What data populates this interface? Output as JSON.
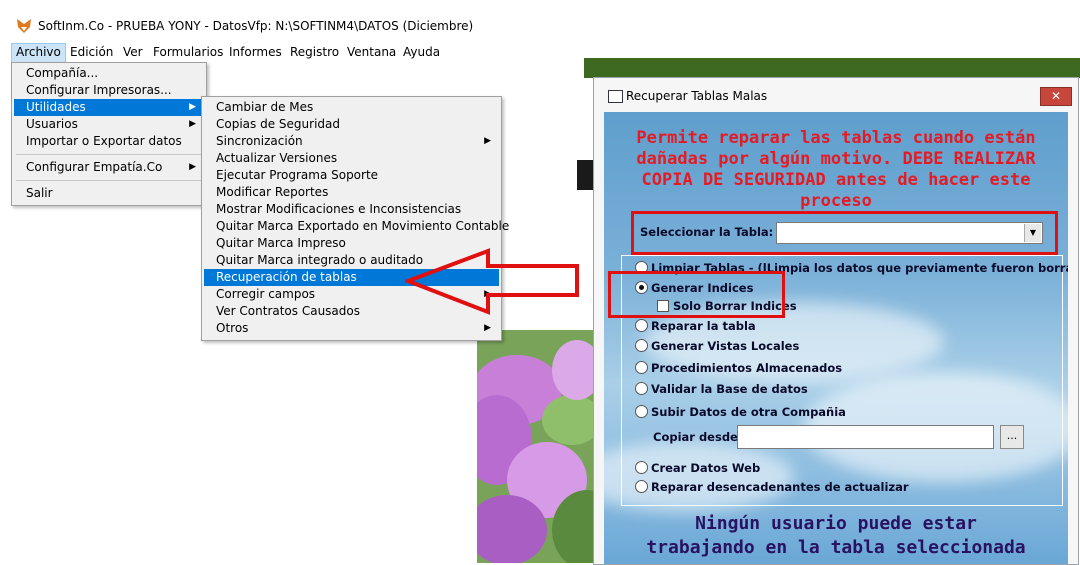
{
  "window": {
    "title": "SoftInm.Co - PRUEBA YONY - DatosVfp: N:\\SOFTINM4\\DATOS  (Diciembre)"
  },
  "menubar": [
    "Archivo",
    "Edición",
    "Ver",
    "Formularios",
    "Informes",
    "Registro",
    "Ventana",
    "Ayuda"
  ],
  "archivo_menu": {
    "items": [
      "Compañía...",
      "Configurar Impresoras...",
      "Utilidades",
      "Usuarios",
      "Importar o Exportar datos",
      "Configurar Empatía.Co",
      "Salir"
    ]
  },
  "utilidades_menu": {
    "items": [
      "Cambiar de Mes",
      "Copias de Seguridad",
      "Sincronización",
      "Actualizar Versiones",
      "Ejecutar Programa Soporte",
      "Modificar Reportes",
      "Mostrar Modificaciones e Inconsistencias",
      "Quitar Marca Exportado en Movimiento Contable",
      "Quitar Marca Impreso",
      "Quitar Marca integrado o auditado",
      "Recuperación de tablas",
      "Corregir campos",
      "Ver Contratos Causados",
      "Otros"
    ]
  },
  "dialog": {
    "title": "Recuperar Tablas Malas",
    "close": "✕",
    "warning_lines": [
      "Permite reparar las tablas cuando están",
      "dañadas por algún motivo. DEBE REALIZAR",
      "COPIA DE SEGURIDAD antes de hacer este",
      "proceso"
    ],
    "select_label": "Seleccionar la Tabla:",
    "select_value": "",
    "options": {
      "limpiar": "Limpiar Tablas - (lLimpia los datos que previamente fueron borrados)",
      "generar": "Generar Indices",
      "solo_borrar": "Solo Borrar Indices",
      "reparar": "Reparar la tabla",
      "vistas": "Generar Vistas Locales",
      "procedimientos": "Procedimientos Almacenados",
      "validar": "Validar la Base de datos",
      "subir": "Subir Datos de otra Compañia",
      "copiar_label": "Copiar desde:",
      "copiar_value": "",
      "browse": "...",
      "web": "Crear Datos Web",
      "desencadenantes": "Reparar desencadenantes de actualizar"
    },
    "footer_lines": [
      "Ningún usuario puede estar",
      "trabajando en la tabla seleccionada"
    ]
  },
  "colors": {
    "highlight": "#0078d7",
    "warning": "#e51b24",
    "annotation": "#e01010",
    "footer": "#2a1262"
  }
}
